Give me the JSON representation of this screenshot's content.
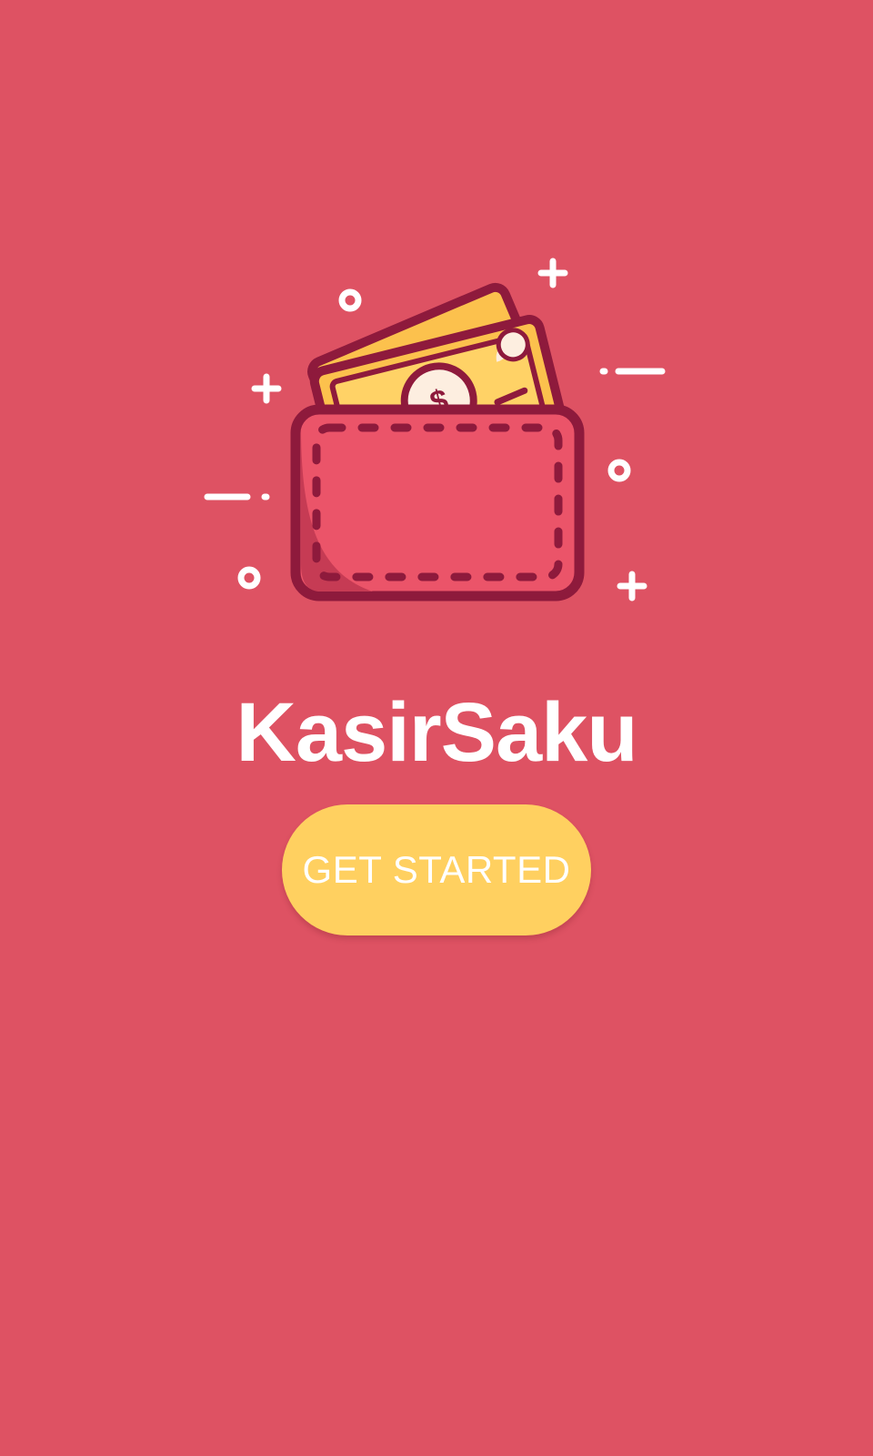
{
  "app": {
    "name": "KasirSaku"
  },
  "onboarding": {
    "get_started_label": "GET STARTED"
  },
  "illustration": {
    "icon": "wallet-with-cash-icon",
    "decorations": [
      "plus-icon",
      "circle-icon",
      "dash-icon"
    ]
  },
  "colors": {
    "background": "#de5263",
    "button": "#ffd060",
    "wallet_body": "#eb5469",
    "wallet_outline": "#8e1a3c",
    "cash": "#fcc14d",
    "text": "#ffffff"
  }
}
